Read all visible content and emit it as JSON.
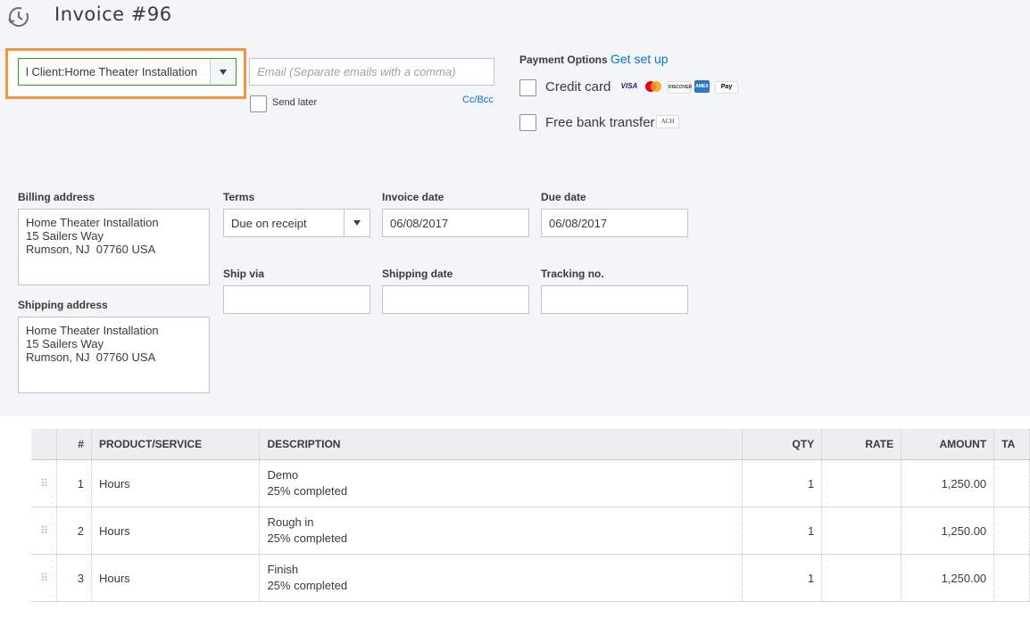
{
  "header": {
    "title": "Invoice #96",
    "icon": "recent-history-icon"
  },
  "customer": {
    "value": "l Client:Home Theater Installation"
  },
  "email": {
    "placeholder": "Email (Separate emails with a comma)",
    "send_later_label": "Send later",
    "ccbcc_label": "Cc/Bcc"
  },
  "payment": {
    "label": "Payment Options",
    "link": "Get set up",
    "credit_card_label": "Credit card",
    "cards": [
      "VISA",
      "MC",
      "DISC",
      "AMEX",
      "Apple Pay"
    ],
    "bank_transfer_label": "Free bank transfer",
    "ach_label": "ACH"
  },
  "billing": {
    "label": "Billing address",
    "value": "Home Theater Installation\n15 Sailers Way\nRumson, NJ  07760 USA"
  },
  "shipping": {
    "label": "Shipping address",
    "value": "Home Theater Installation\n15 Sailers Way\nRumson, NJ  07760 USA"
  },
  "terms": {
    "label": "Terms",
    "value": "Due on receipt"
  },
  "invoice_date": {
    "label": "Invoice date",
    "value": "06/08/2017"
  },
  "due_date": {
    "label": "Due date",
    "value": "06/08/2017"
  },
  "ship_via": {
    "label": "Ship via",
    "value": ""
  },
  "shipping_date": {
    "label": "Shipping date",
    "value": ""
  },
  "tracking": {
    "label": "Tracking no.",
    "value": ""
  },
  "table": {
    "headers": [
      "#",
      "PRODUCT/SERVICE",
      "DESCRIPTION",
      "QTY",
      "RATE",
      "AMOUNT",
      "TA"
    ],
    "rows": [
      {
        "num": "1",
        "product": "Hours",
        "desc1": "Demo",
        "desc2": "25% completed",
        "qty": "1",
        "rate": "",
        "amount": "1,250.00"
      },
      {
        "num": "2",
        "product": "Hours",
        "desc1": "Rough in",
        "desc2": "25% completed",
        "qty": "1",
        "rate": "",
        "amount": "1,250.00"
      },
      {
        "num": "3",
        "product": "Hours",
        "desc1": "Finish",
        "desc2": "25% completed",
        "qty": "1",
        "rate": "",
        "amount": "1,250.00"
      }
    ]
  },
  "colors": {
    "accent_green": "#2ca01c",
    "highlight_orange": "#f2963b",
    "link_blue": "#0077c5"
  }
}
